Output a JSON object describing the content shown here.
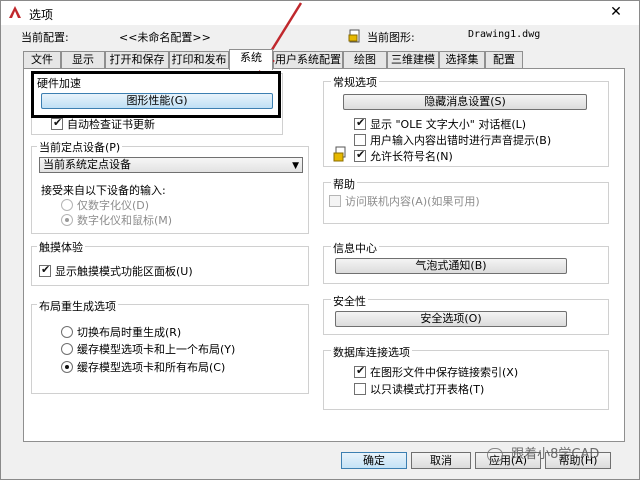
{
  "window": {
    "title": "选项",
    "close": "✕"
  },
  "info": {
    "profile_label": "当前配置:",
    "profile_value": "<<未命名配置>>",
    "drawing_label": "当前图形:",
    "drawing_value": "Drawing1.dwg"
  },
  "tabs": [
    {
      "label": "文件"
    },
    {
      "label": "显示"
    },
    {
      "label": "打开和保存"
    },
    {
      "label": "打印和发布"
    },
    {
      "label": "系统"
    },
    {
      "label": "用户系统配置"
    },
    {
      "label": "绘图"
    },
    {
      "label": "三维建模"
    },
    {
      "label": "选择集"
    },
    {
      "label": "配置"
    }
  ],
  "hardware": {
    "title": "硬件加速",
    "graphics_button": "图形性能(G)",
    "auto_check": "自动检查证书更新"
  },
  "pointing": {
    "title": "当前定点设备(P)",
    "device": "当前系统定点设备",
    "accept_label": "接受来自以下设备的输入:",
    "digitizer_only": "仅数字化仪(D)",
    "digitizer_mouse": "数字化仪和鼠标(M)"
  },
  "touch": {
    "title": "触摸体验",
    "ribbon": "显示触摸模式功能区面板(U)"
  },
  "layout": {
    "title": "布局重生成选项",
    "opt1": "切换布局时重生成(R)",
    "opt2": "缓存模型选项卡和上一个布局(Y)",
    "opt3": "缓存模型选项卡和所有布局(C)"
  },
  "general": {
    "title": "常规选项",
    "hidden_msgs": "隐藏消息设置(S)",
    "ole": "显示 \"OLE 文字大小\" 对话框(L)",
    "beep": "用户输入内容出错时进行声音提示(B)",
    "longnames": "允许长符号名(N)"
  },
  "help": {
    "title": "帮助",
    "online": "访问联机内容(A)(如果可用)"
  },
  "info_center": {
    "title": "信息中心",
    "balloon": "气泡式通知(B)"
  },
  "security": {
    "title": "安全性",
    "options": "安全选项(O)"
  },
  "dbconnect": {
    "title": "数据库连接选项",
    "store_index": "在图形文件中保存链接索引(X)",
    "readonly": "以只读模式打开表格(T)"
  },
  "footer": {
    "ok": "确定",
    "cancel": "取消",
    "apply": "应用(A)",
    "help": "帮助(H)"
  },
  "watermark": "跟着小8学CAD",
  "colors": {
    "accent": "#3c7fb1",
    "highlight": "#000000",
    "arrow": "#c0282d"
  }
}
